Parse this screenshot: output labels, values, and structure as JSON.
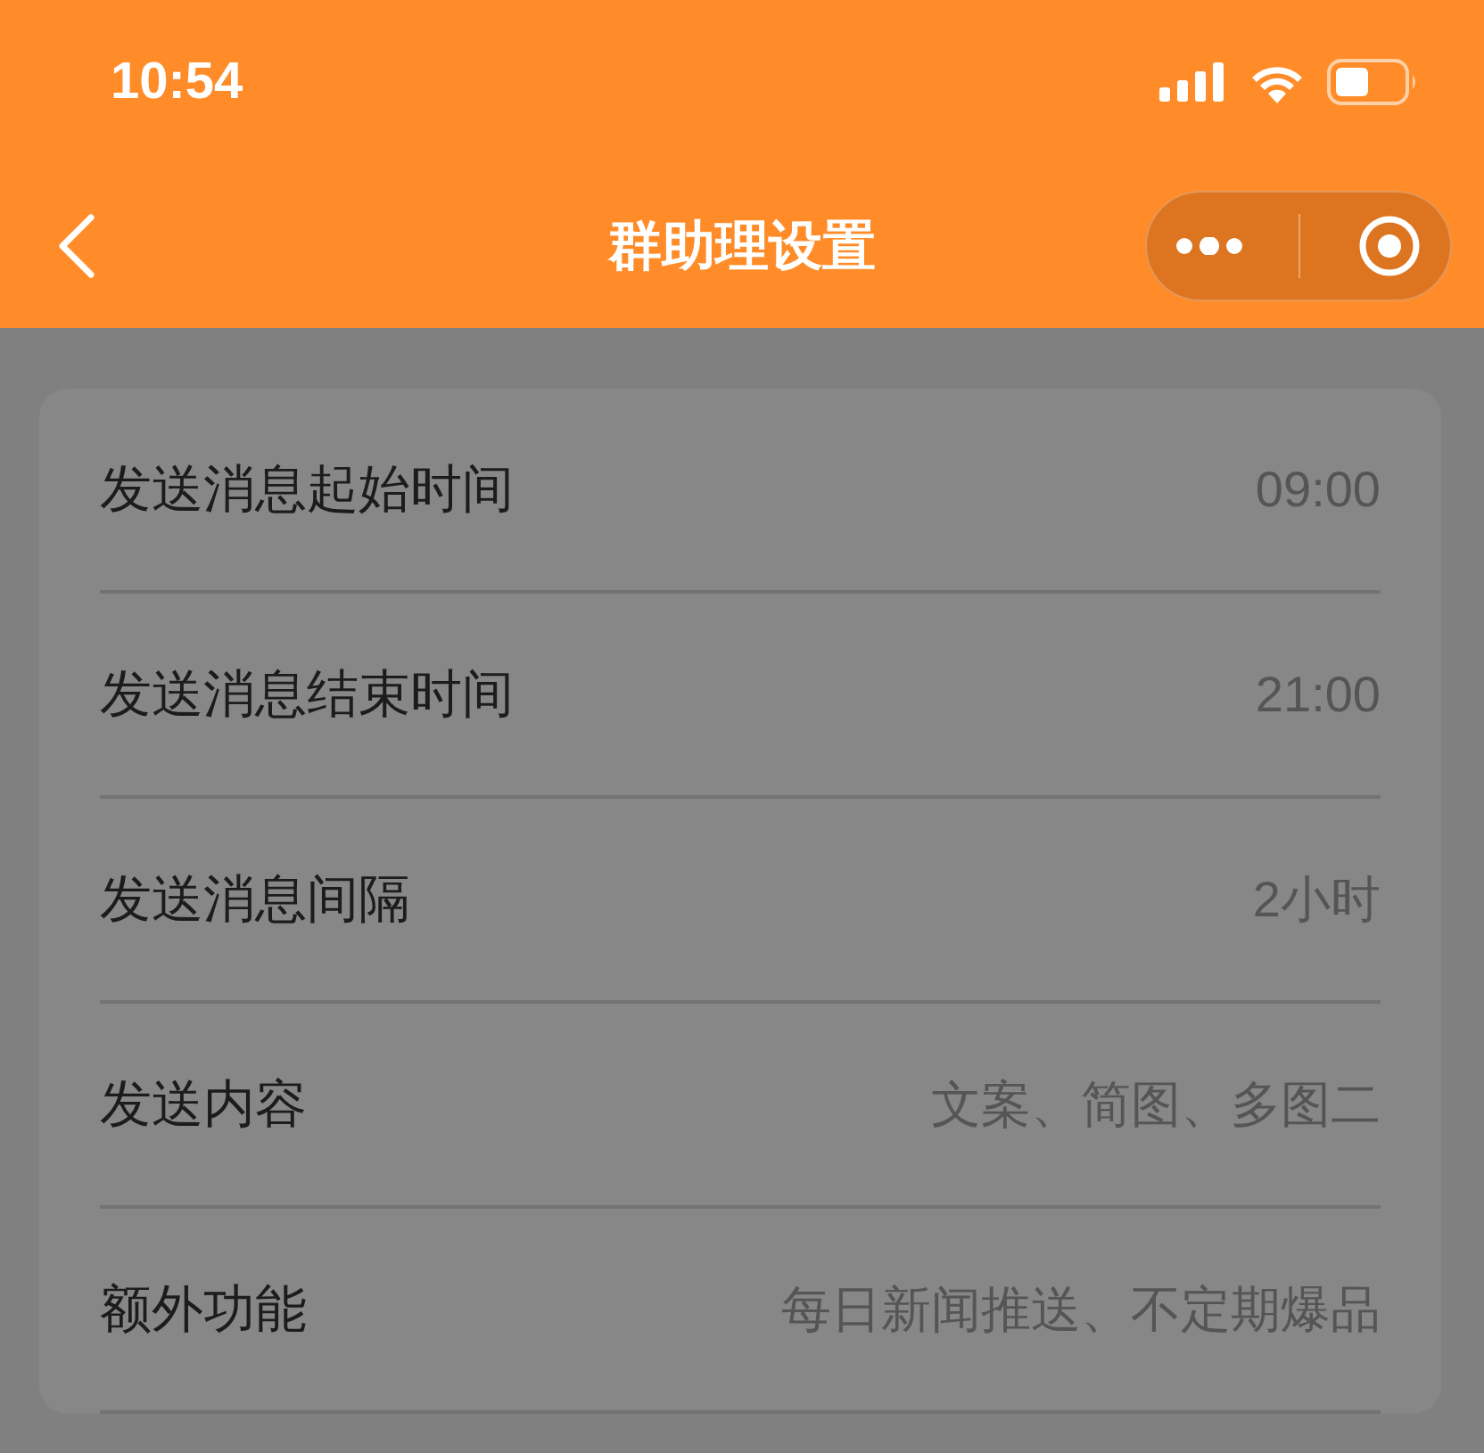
{
  "status_bar": {
    "time": "10:54"
  },
  "nav": {
    "title": "群助理设置"
  },
  "settings": [
    {
      "label": "发送消息起始时间",
      "value": "09:00"
    },
    {
      "label": "发送消息结束时间",
      "value": "21:00"
    },
    {
      "label": "发送消息间隔",
      "value": "2小时"
    },
    {
      "label": "发送内容",
      "value": "文案、简图、多图二"
    },
    {
      "label": "额外功能",
      "value": "每日新闻推送、不定期爆品"
    }
  ]
}
